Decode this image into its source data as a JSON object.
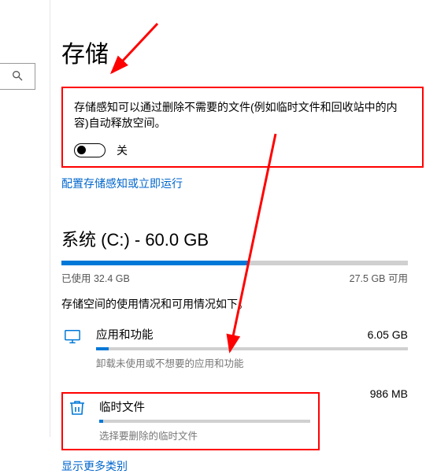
{
  "page_title": "存储",
  "storage_sense": {
    "description": "存储感知可以通过删除不需要的文件(例如临时文件和回收站中的内容)自动释放空间。",
    "toggle_label": "关",
    "config_link": "配置存储感知或立即运行"
  },
  "drive": {
    "title": "系统 (C:) - 60.0 GB",
    "used_label": "已使用 32.4 GB",
    "free_label": "27.5 GB 可用",
    "used_fraction": 0.54,
    "caption": "存储空间的使用情况和可用情况如下。"
  },
  "categories": [
    {
      "icon": "monitor",
      "name": "应用和功能",
      "size": "6.05 GB",
      "subtitle": "卸载未使用或不想要的应用和功能",
      "fill": 0.04
    },
    {
      "icon": "trash",
      "name": "临时文件",
      "size": "986 MB",
      "subtitle": "选择要删除的临时文件",
      "fill": 0.02
    }
  ],
  "more_link": "显示更多类别"
}
